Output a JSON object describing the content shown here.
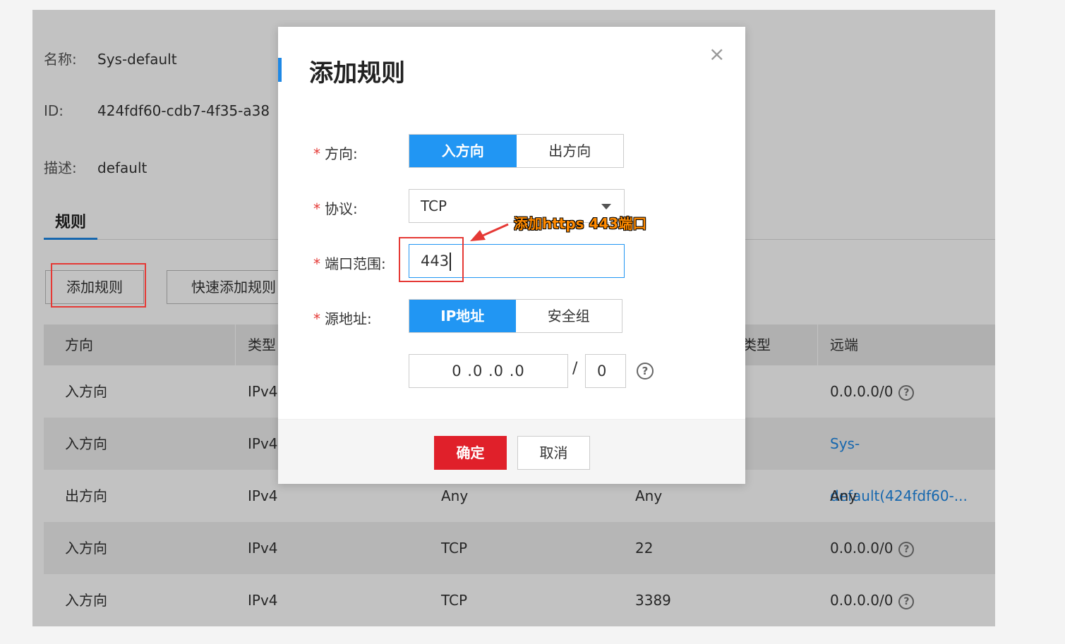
{
  "info": {
    "name_label": "名称:",
    "name_value": "Sys-default",
    "id_label": "ID:",
    "id_value": "424fdf60-cdb7-4f35-a38",
    "desc_label": "描述:",
    "desc_value": "default"
  },
  "tabs": {
    "rules": "规则"
  },
  "actions": {
    "add_rule": "添加规则",
    "quick_add_rule": "快速添加规则"
  },
  "table": {
    "headers": [
      "方向",
      "类型",
      "",
      "类型",
      "远端"
    ],
    "header_partial_col4": "类型",
    "rows": [
      {
        "direction": "入方向",
        "type": "IPv4",
        "protocol": "",
        "port": "",
        "remote": "0.0.0.0/0",
        "remote_help": true
      },
      {
        "direction": "入方向",
        "type": "IPv4",
        "protocol": "",
        "port": "",
        "remote": "Sys-default(424fdf60-...",
        "remote_link": true
      },
      {
        "direction": "出方向",
        "type": "IPv4",
        "protocol": "Any",
        "port": "Any",
        "remote": "Any"
      },
      {
        "direction": "入方向",
        "type": "IPv4",
        "protocol": "TCP",
        "port": "22",
        "remote": "0.0.0.0/0",
        "remote_help": true
      },
      {
        "direction": "入方向",
        "type": "IPv4",
        "protocol": "TCP",
        "port": "3389",
        "remote": "0.0.0.0/0",
        "remote_help": true
      }
    ]
  },
  "modal": {
    "title": "添加规则",
    "close": "×",
    "direction_label": "方向:",
    "direction_options": [
      "入方向",
      "出方向"
    ],
    "protocol_label": "协议:",
    "protocol_value": "TCP",
    "port_label": "端口范围:",
    "port_value": "443",
    "source_label": "源地址:",
    "source_options": [
      "IP地址",
      "安全组"
    ],
    "ip_value": "0 .0 .0 .0",
    "slash": "/",
    "mask_value": "0",
    "help": "?",
    "ok": "确定",
    "cancel": "取消"
  },
  "annotation": {
    "note": "添加https 443端口",
    "color": "#e53935"
  },
  "colors": {
    "primary": "#2196f3",
    "danger": "#e0202a",
    "link": "#1e88e5"
  }
}
